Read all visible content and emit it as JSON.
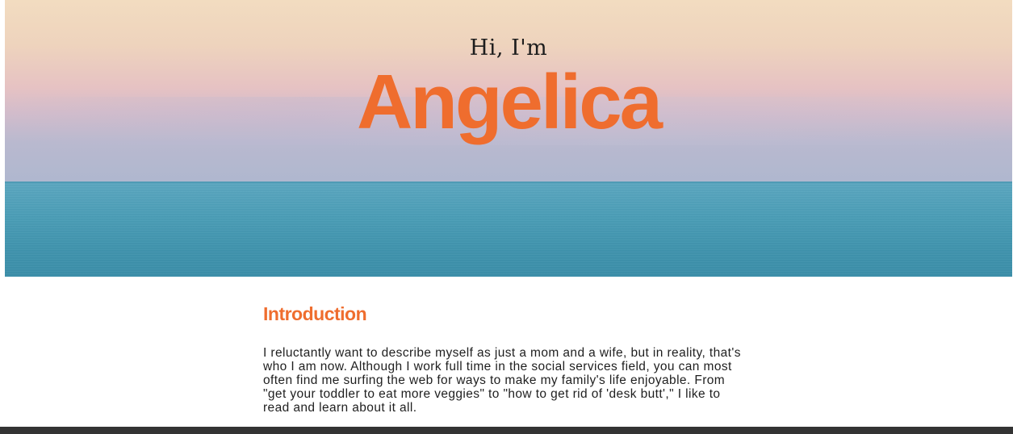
{
  "hero": {
    "greeting": "Hi, I'm",
    "name": "Angelica"
  },
  "intro": {
    "title": "Introduction",
    "text": "I reluctantly want to describe myself as just a mom and a wife, but in reality, that's who I am now. Although I work full time in the social services field, you can most often find me surfing the web for ways to make my family's life enjoyable. From \"get your toddler to eat more veggies\" to \"how to get rid of 'desk butt',\" I like to read and learn about it all."
  },
  "colors": {
    "accent": "#ef6d2e",
    "footer": "#333333",
    "sea": "#4a9db6"
  }
}
